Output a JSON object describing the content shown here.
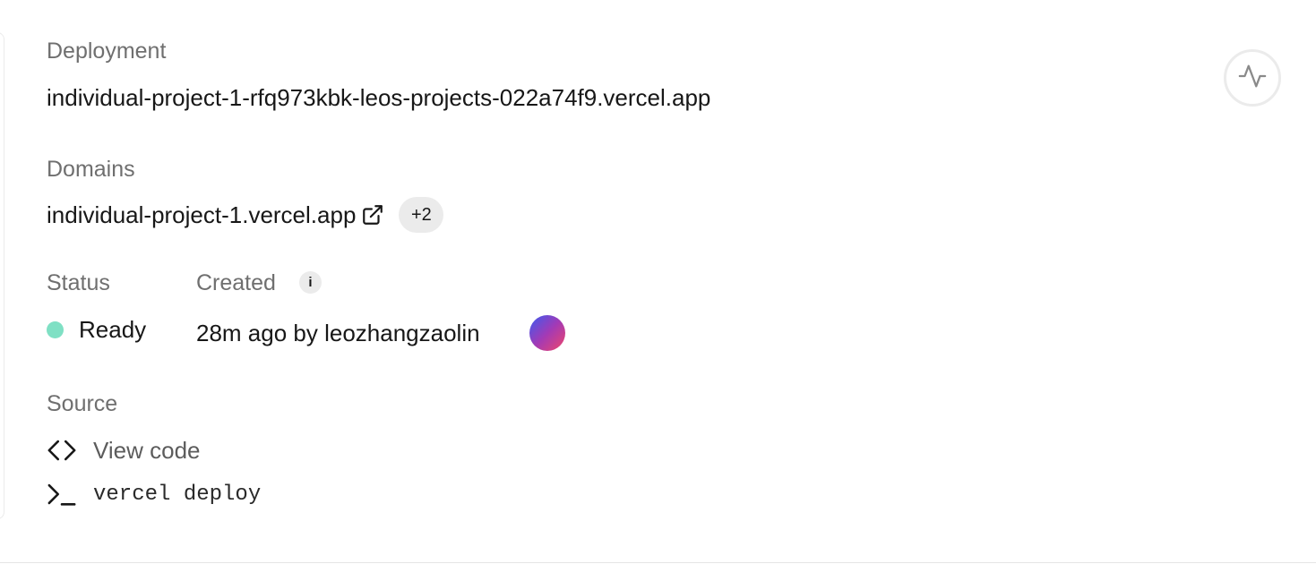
{
  "deployment": {
    "label": "Deployment",
    "url": "individual-project-1-rfq973kbk-leos-projects-022a74f9.vercel.app"
  },
  "domains": {
    "label": "Domains",
    "primary": "individual-project-1.vercel.app",
    "extra_count": "+2"
  },
  "status": {
    "label": "Status",
    "value": "Ready",
    "color": "#7fe0c4"
  },
  "created": {
    "label": "Created",
    "info_glyph": "i",
    "value": "28m ago by leozhangzaolin"
  },
  "source": {
    "label": "Source",
    "view_code": "View code",
    "command": "vercel deploy"
  },
  "icons": {
    "activity": "activity-icon",
    "external_link": "external-link-icon",
    "code": "code-icon",
    "terminal": "terminal-icon"
  }
}
